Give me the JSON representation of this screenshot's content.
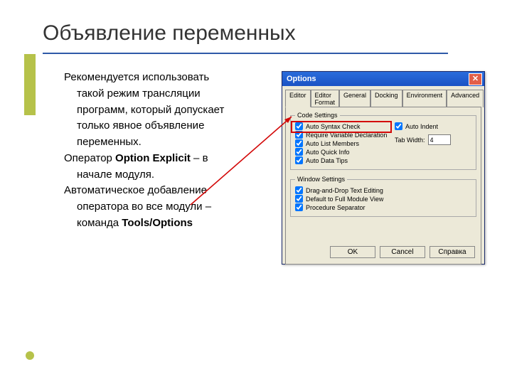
{
  "title": "Объявление переменных",
  "body": {
    "p1a": "Рекомендуется использовать",
    "p1b": "такой режим трансляции",
    "p1c": "программ, который допускает",
    "p1d": "только явное объявление",
    "p1e": "переменных.",
    "p2a": "Оператор ",
    "p2b": "Option Explicit",
    "p2c": " – в",
    "p2d": "начале модуля.",
    "p3a": "Автоматическое добавление",
    "p3b": "оператора во все модули –",
    "p3c": "команда ",
    "p3d": "Tools/Options"
  },
  "dialog": {
    "title": "Options",
    "tabs": {
      "editor": "Editor",
      "format": "Editor Format",
      "general": "General",
      "docking": "Docking",
      "environment": "Environment",
      "advanced": "Advanced"
    },
    "groups": {
      "code": "Code Settings",
      "window": "Window Settings"
    },
    "opts": {
      "autoSyntax": "Auto Syntax Check",
      "requireVar": "Require Variable Declaration",
      "autoList": "Auto List Members",
      "autoQuick": "Auto Quick Info",
      "autoData": "Auto Data Tips",
      "autoIndent": "Auto Indent",
      "tabWidthLabel": "Tab Width:",
      "tabWidthValue": "4",
      "dragDrop": "Drag-and-Drop Text Editing",
      "fullModule": "Default to Full Module View",
      "procSep": "Procedure Separator"
    },
    "buttons": {
      "ok": "OK",
      "cancel": "Cancel",
      "help": "Справка"
    }
  }
}
